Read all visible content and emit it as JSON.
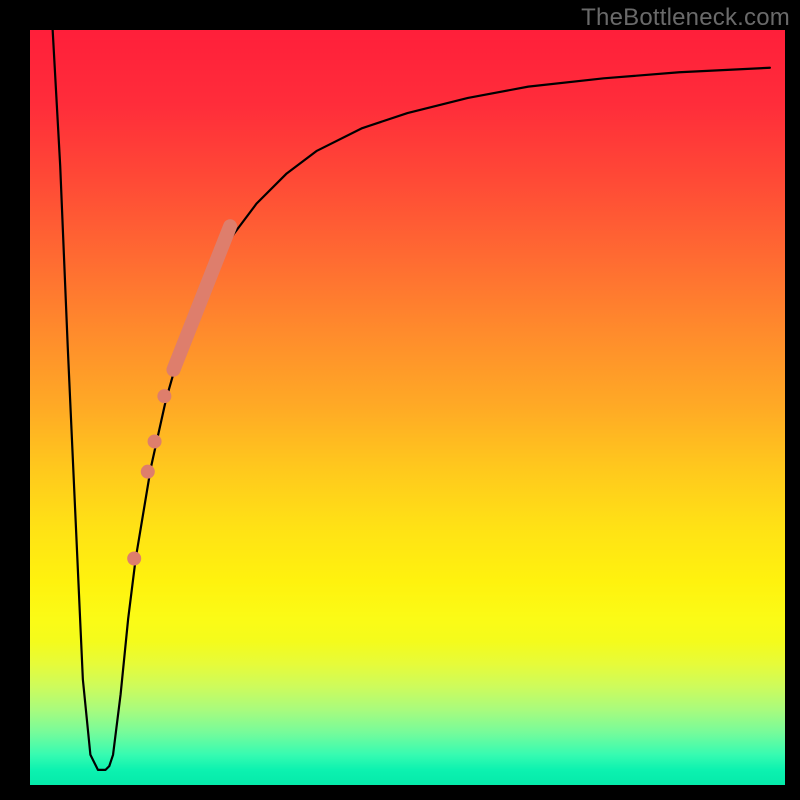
{
  "watermark": "TheBottleneck.com",
  "chart_data": {
    "type": "line",
    "title": "",
    "xlabel": "",
    "ylabel": "",
    "xlim": [
      0,
      100
    ],
    "ylim": [
      0,
      100
    ],
    "series": [
      {
        "name": "bottleneck-curve",
        "x": [
          3,
          4,
          5,
          6,
          7,
          8,
          9,
          10,
          10.5,
          11,
          12,
          13,
          14,
          16,
          18,
          20,
          22,
          24,
          27,
          30,
          34,
          38,
          44,
          50,
          58,
          66,
          76,
          86,
          98
        ],
        "y": [
          100,
          82,
          58,
          36,
          14,
          4,
          2,
          2,
          2.5,
          4,
          12,
          22,
          30,
          42,
          51,
          58,
          64,
          68,
          73,
          77,
          81,
          84,
          87,
          89,
          91,
          92.5,
          93.6,
          94.4,
          95
        ]
      }
    ],
    "highlighted_line": {
      "name": "thick-segment",
      "x": [
        19,
        26.5
      ],
      "y": [
        55,
        74
      ]
    },
    "highlighted_points": {
      "name": "dots",
      "x": [
        13.8,
        15.6,
        16.5,
        17.8
      ],
      "y": [
        30,
        41.5,
        45.5,
        51.5
      ]
    },
    "colors": {
      "curve": "#000000",
      "highlight": "#de7e6c",
      "background_top": "#ff1f3a",
      "background_bottom": "#05eaaa"
    }
  }
}
